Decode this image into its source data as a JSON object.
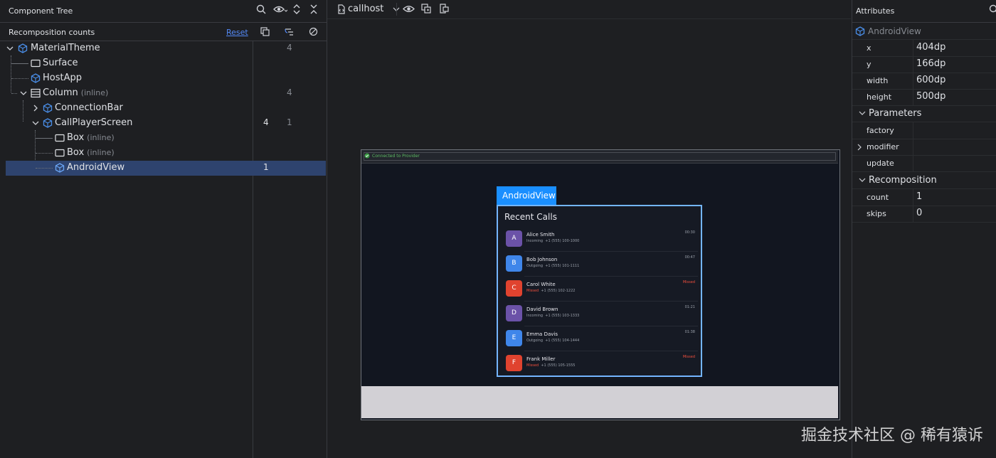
{
  "left_panel": {
    "title": "Component Tree",
    "recomp_label": "Recomposition counts",
    "reset_label": "Reset",
    "tree": [
      {
        "label": "MaterialTheme",
        "sub": "",
        "icon": "compose-icon",
        "c1": "",
        "c2": "4"
      },
      {
        "label": "Surface",
        "sub": "",
        "icon": "box-icon",
        "c1": "",
        "c2": ""
      },
      {
        "label": "HostApp",
        "sub": "",
        "icon": "compose-icon",
        "c1": "",
        "c2": ""
      },
      {
        "label": "Column",
        "sub": "(inline)",
        "icon": "column-icon",
        "c1": "",
        "c2": "4"
      },
      {
        "label": "ConnectionBar",
        "sub": "",
        "icon": "compose-icon",
        "c1": "",
        "c2": ""
      },
      {
        "label": "CallPlayerScreen",
        "sub": "",
        "icon": "compose-icon",
        "c1": "4",
        "c2": "1"
      },
      {
        "label": "Box",
        "sub": "(inline)",
        "icon": "box-icon",
        "c1": "",
        "c2": ""
      },
      {
        "label": "Box",
        "sub": "(inline)",
        "icon": "box-icon",
        "c1": "",
        "c2": ""
      },
      {
        "label": "AndroidView",
        "sub": "",
        "icon": "compose-icon",
        "c1": "1",
        "c2": ""
      }
    ]
  },
  "toolbar": {
    "device_label": "callhost"
  },
  "preview": {
    "connection_text": "Connected to Provider",
    "tab_label": "AndroidView",
    "list_title": "Recent Calls",
    "calls": [
      {
        "initial": "A",
        "name": "Alice Smith",
        "type": "Incoming",
        "number": "+1 (555) 100-1000",
        "duration": "00:30",
        "color": "#6b52a8"
      },
      {
        "initial": "B",
        "name": "Bob Johnson",
        "type": "Outgoing",
        "number": "+1 (555) 101-1111",
        "duration": "00:47",
        "color": "#3f86ea"
      },
      {
        "initial": "C",
        "name": "Carol White",
        "type": "Missed",
        "number": "+1 (555) 102-1222",
        "duration": "Missed",
        "color": "#e0432f"
      },
      {
        "initial": "D",
        "name": "David Brown",
        "type": "Incoming",
        "number": "+1 (555) 103-1333",
        "duration": "01:21",
        "color": "#6b52a8"
      },
      {
        "initial": "E",
        "name": "Emma Davis",
        "type": "Outgoing",
        "number": "+1 (555) 104-1444",
        "duration": "01:38",
        "color": "#3f86ea"
      },
      {
        "initial": "F",
        "name": "Frank Miller",
        "type": "Missed",
        "number": "+1 (555) 105-1555",
        "duration": "Missed",
        "color": "#e0432f"
      }
    ]
  },
  "right_panel": {
    "title": "Attributes",
    "component": "AndroidView",
    "attrs": [
      {
        "key": "x",
        "value": "404dp"
      },
      {
        "key": "y",
        "value": "166dp"
      },
      {
        "key": "width",
        "value": "600dp"
      },
      {
        "key": "height",
        "value": "500dp"
      }
    ],
    "parameters_label": "Parameters",
    "params": [
      {
        "key": "factory",
        "value": ""
      },
      {
        "key": "modifier",
        "value": ""
      },
      {
        "key": "update",
        "value": ""
      }
    ],
    "recomposition_label": "Recomposition",
    "recomp": [
      {
        "key": "count",
        "value": "1"
      },
      {
        "key": "skips",
        "value": "0"
      }
    ]
  },
  "watermark": "掘金技术社区 @ 稀有猿诉"
}
